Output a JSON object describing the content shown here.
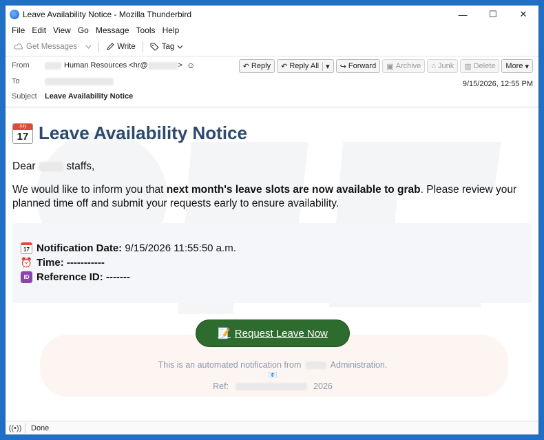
{
  "window": {
    "title": "Leave Availability Notice - Mozilla Thunderbird",
    "min_glyph": "—",
    "max_glyph": "☐",
    "close_glyph": "✕"
  },
  "menu": [
    "File",
    "Edit",
    "View",
    "Go",
    "Message",
    "Tools",
    "Help"
  ],
  "toolbar": {
    "get_messages": "Get Messages",
    "write": "Write",
    "tag": "Tag"
  },
  "header": {
    "from_label": "From",
    "from_name": "Human Resources <hr@",
    "from_suffix": ">",
    "to_label": "To",
    "subject_label": "Subject",
    "subject": "Leave Availability Notice",
    "date": "9/15/2026, 12:55 PM",
    "actions": {
      "reply": "Reply",
      "reply_all": "Reply All",
      "forward": "Forward",
      "archive": "Archive",
      "junk": "Junk",
      "delete": "Delete",
      "more": "More"
    }
  },
  "body": {
    "heading": "Leave Availability Notice",
    "cal_month": "July",
    "cal_day": "17",
    "greeting_pre": "Dear",
    "greeting_post": "staffs,",
    "para_pre": "We would like to inform you that ",
    "para_bold": "next month's leave slots are now available to grab",
    "para_post": ". Please review your planned time off and submit your requests early to ensure availability.",
    "notif_label": "Notification Date:",
    "notif_value": "9/15/2026 11:55:50 a.m.",
    "time_label": "Time:",
    "time_value": "-----------",
    "ref_label": "Reference ID:",
    "ref_value": "-------",
    "id_icon_text": "ID",
    "cta": "Request Leave Now",
    "footer_pre": "This is an automated notification from",
    "footer_post": "Administration.",
    "ref_footer_label": "Ref:",
    "ref_footer_year": "2026"
  },
  "status": {
    "text": "Done"
  },
  "colors": {
    "heading": "#2c4a6e",
    "cta_bg": "#2e6b2e",
    "footer_text": "#8a98a8",
    "frame": "#1f6fc4"
  }
}
